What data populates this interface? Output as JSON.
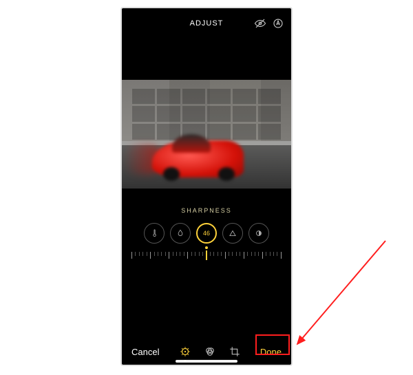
{
  "header": {
    "title": "ADJUST",
    "icons": {
      "visibility": "eye-off-icon",
      "markup": "markup-icon"
    }
  },
  "edit": {
    "tool_label": "SHARPNESS",
    "active_value": "46",
    "circles": [
      {
        "name": "warmth",
        "icon": "thermometer-icon"
      },
      {
        "name": "tint",
        "icon": "drop-icon"
      },
      {
        "name": "sharpness",
        "icon": "value",
        "active": true
      },
      {
        "name": "definition",
        "icon": "triangle-icon"
      },
      {
        "name": "noise",
        "icon": "half-circle-icon"
      }
    ]
  },
  "bottom": {
    "cancel_label": "Cancel",
    "done_label": "Done",
    "modes": [
      {
        "name": "adjust",
        "icon": "dial-icon",
        "active": true
      },
      {
        "name": "filters",
        "icon": "filters-icon",
        "active": false
      },
      {
        "name": "crop",
        "icon": "crop-icon",
        "active": false
      }
    ]
  },
  "annotation": {
    "highlight": "done-button",
    "color": "#ff1e1e"
  }
}
